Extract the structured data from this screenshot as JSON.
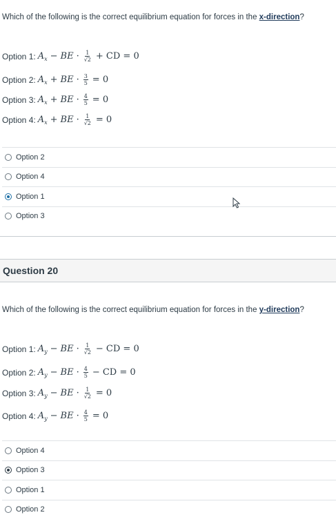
{
  "q19": {
    "prompt_pre": "Which of the following is the correct equilibrium equation for forces in the ",
    "prompt_dir": "x-direction",
    "prompt_post": "?",
    "options": [
      {
        "label": "Option 1:",
        "eq": {
          "var": "A",
          "sub": "x",
          "sign1": "−",
          "term": "BE",
          "num": "1",
          "den": "√2",
          "tail": "+ CD = 0"
        }
      },
      {
        "label": "Option 2:",
        "eq": {
          "var": "A",
          "sub": "x",
          "sign1": "+",
          "term": "BE",
          "num": "3",
          "den": "5",
          "tail": "= 0"
        }
      },
      {
        "label": "Option 3:",
        "eq": {
          "var": "A",
          "sub": "x",
          "sign1": "+",
          "term": "BE",
          "num": "4",
          "den": "5",
          "tail": "= 0"
        }
      },
      {
        "label": "Option 4:",
        "eq": {
          "var": "A",
          "sub": "x",
          "sign1": "+",
          "term": "BE",
          "num": "1",
          "den": "√2",
          "tail": "= 0"
        }
      }
    ],
    "answers": [
      "Option 2",
      "Option 4",
      "Option 1",
      "Option 3"
    ],
    "selected_index": 2
  },
  "q20": {
    "header": "Question 20",
    "prompt_pre": "Which of the following is the correct equilibrium equation for forces in the ",
    "prompt_dir": "y-direction",
    "prompt_post": "?",
    "options": [
      {
        "label": "Option 1:",
        "eq": {
          "var": "A",
          "sub": "y",
          "sign1": "−",
          "term": "BE",
          "num": "1",
          "den": "√2",
          "tail": "− CD = 0"
        }
      },
      {
        "label": "Option 2:",
        "eq": {
          "var": "A",
          "sub": "y",
          "sign1": "−",
          "term": "BE",
          "num": "4",
          "den": "5",
          "tail": "− CD = 0"
        }
      },
      {
        "label": "Option 3:",
        "eq": {
          "var": "A",
          "sub": "y",
          "sign1": "−",
          "term": "BE",
          "num": "1",
          "den": "√2",
          "tail": "= 0"
        }
      },
      {
        "label": "Option 4:",
        "eq": {
          "var": "A",
          "sub": "y",
          "sign1": "−",
          "term": "BE",
          "num": "4",
          "den": "5",
          "tail": "= 0"
        }
      }
    ],
    "answers": [
      "Option 4",
      "Option 3",
      "Option 1",
      "Option 2"
    ],
    "selected_index": 1
  },
  "colors": {
    "text": "#2d3b45",
    "link": "#1f3a5a",
    "radio_selected_q19": "#1d6fa5",
    "radio_selected_q20": "#2d3b45",
    "header_bg": "#f5f5f5"
  }
}
